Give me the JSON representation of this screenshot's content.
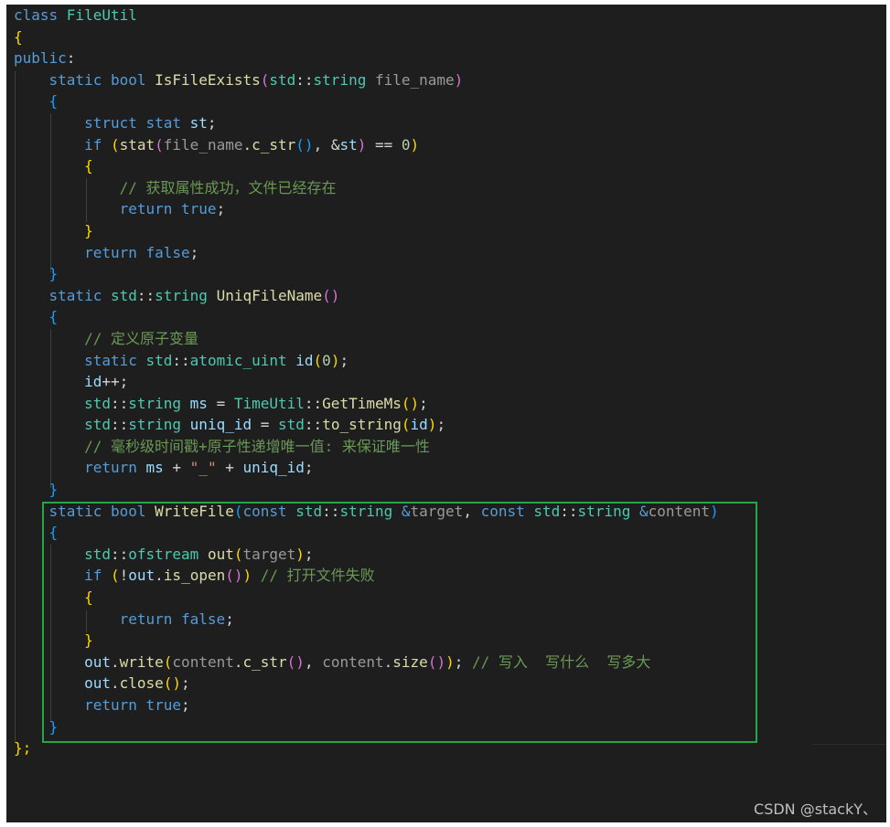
{
  "code_lines": [
    [
      {
        "t": "class ",
        "c": "kw"
      },
      {
        "t": "FileUtil",
        "c": "ty"
      }
    ],
    [
      {
        "t": "{",
        "c": "b1"
      }
    ],
    [
      {
        "t": "public",
        "c": "kw"
      },
      {
        "t": ":",
        "c": "pn"
      }
    ],
    [
      {
        "t": "    static bool ",
        "c": "kw"
      },
      {
        "t": "IsFileExists",
        "c": "fn"
      },
      {
        "t": "(",
        "c": "b2"
      },
      {
        "t": "std",
        "c": "ty"
      },
      {
        "t": "::",
        "c": "pn"
      },
      {
        "t": "string",
        "c": "ty"
      },
      {
        "t": " file_name",
        "c": "prm"
      },
      {
        "t": ")",
        "c": "b2"
      }
    ],
    [
      {
        "t": "    {",
        "c": "b3"
      }
    ],
    [
      {
        "t": "        struct stat ",
        "c": "kw"
      },
      {
        "t": "st",
        "c": "var"
      },
      {
        "t": ";",
        "c": "pn"
      }
    ],
    [
      {
        "t": "        if ",
        "c": "kw"
      },
      {
        "t": "(",
        "c": "b1"
      },
      {
        "t": "stat",
        "c": "fn"
      },
      {
        "t": "(",
        "c": "b2"
      },
      {
        "t": "file_name",
        "c": "prm"
      },
      {
        "t": ".",
        "c": "pn"
      },
      {
        "t": "c_str",
        "c": "fn"
      },
      {
        "t": "()",
        "c": "b3"
      },
      {
        "t": ", &",
        "c": "pn"
      },
      {
        "t": "st",
        "c": "var"
      },
      {
        "t": ")",
        "c": "b2"
      },
      {
        "t": " == ",
        "c": "pn"
      },
      {
        "t": "0",
        "c": "num"
      },
      {
        "t": ")",
        "c": "b1"
      }
    ],
    [
      {
        "t": "        {",
        "c": "b1"
      }
    ],
    [
      {
        "t": "            // 获取属性成功，文件已经存在",
        "c": "cm"
      }
    ],
    [
      {
        "t": "            return true",
        "c": "kw"
      },
      {
        "t": ";",
        "c": "pn"
      }
    ],
    [
      {
        "t": "        }",
        "c": "b1"
      }
    ],
    [
      {
        "t": "        return false",
        "c": "kw"
      },
      {
        "t": ";",
        "c": "pn"
      }
    ],
    [
      {
        "t": "    }",
        "c": "b3"
      }
    ],
    [
      {
        "t": "    static ",
        "c": "kw"
      },
      {
        "t": "std",
        "c": "ty"
      },
      {
        "t": "::",
        "c": "pn"
      },
      {
        "t": "string ",
        "c": "ty"
      },
      {
        "t": "UniqFileName",
        "c": "fn"
      },
      {
        "t": "()",
        "c": "b2"
      }
    ],
    [
      {
        "t": "    {",
        "c": "b3"
      }
    ],
    [
      {
        "t": "        // 定义原子变量",
        "c": "cm"
      }
    ],
    [
      {
        "t": "        static ",
        "c": "kw"
      },
      {
        "t": "std",
        "c": "ty"
      },
      {
        "t": "::",
        "c": "pn"
      },
      {
        "t": "atomic_uint ",
        "c": "ty"
      },
      {
        "t": "id",
        "c": "var"
      },
      {
        "t": "(",
        "c": "b1"
      },
      {
        "t": "0",
        "c": "num"
      },
      {
        "t": ")",
        "c": "b1"
      },
      {
        "t": ";",
        "c": "pn"
      }
    ],
    [
      {
        "t": "        ",
        "c": "pn"
      },
      {
        "t": "id",
        "c": "var"
      },
      {
        "t": "++;",
        "c": "pn"
      }
    ],
    [
      {
        "t": "        ",
        "c": "pn"
      },
      {
        "t": "std",
        "c": "ty"
      },
      {
        "t": "::",
        "c": "pn"
      },
      {
        "t": "string ",
        "c": "ty"
      },
      {
        "t": "ms",
        "c": "var"
      },
      {
        "t": " = ",
        "c": "pn"
      },
      {
        "t": "TimeUtil",
        "c": "ty"
      },
      {
        "t": "::",
        "c": "pn"
      },
      {
        "t": "GetTimeMs",
        "c": "fn"
      },
      {
        "t": "()",
        "c": "b1"
      },
      {
        "t": ";",
        "c": "pn"
      }
    ],
    [
      {
        "t": "        ",
        "c": "pn"
      },
      {
        "t": "std",
        "c": "ty"
      },
      {
        "t": "::",
        "c": "pn"
      },
      {
        "t": "string ",
        "c": "ty"
      },
      {
        "t": "uniq_id",
        "c": "var"
      },
      {
        "t": " = ",
        "c": "pn"
      },
      {
        "t": "std",
        "c": "ty"
      },
      {
        "t": "::",
        "c": "pn"
      },
      {
        "t": "to_string",
        "c": "fn"
      },
      {
        "t": "(",
        "c": "b1"
      },
      {
        "t": "id",
        "c": "var"
      },
      {
        "t": ")",
        "c": "b1"
      },
      {
        "t": ";",
        "c": "pn"
      }
    ],
    [
      {
        "t": "        // 毫秒级时间戳+原子性递增唯一值: 来保证唯一性",
        "c": "cm"
      }
    ],
    [
      {
        "t": "        return ",
        "c": "kw"
      },
      {
        "t": "ms",
        "c": "var"
      },
      {
        "t": " + ",
        "c": "pn"
      },
      {
        "t": "\"_\"",
        "c": "str"
      },
      {
        "t": " + ",
        "c": "pn"
      },
      {
        "t": "uniq_id",
        "c": "var"
      },
      {
        "t": ";",
        "c": "pn"
      }
    ],
    [
      {
        "t": "    }",
        "c": "b3"
      }
    ],
    [
      {
        "t": "    static bool ",
        "c": "kw"
      },
      {
        "t": "WriteFile",
        "c": "fn"
      },
      {
        "t": "(",
        "c": "b3"
      },
      {
        "t": "const ",
        "c": "kw"
      },
      {
        "t": "std",
        "c": "ty"
      },
      {
        "t": "::",
        "c": "pn"
      },
      {
        "t": "string ",
        "c": "ty"
      },
      {
        "t": "&",
        "c": "kw"
      },
      {
        "t": "target",
        "c": "prm"
      },
      {
        "t": ", ",
        "c": "pn"
      },
      {
        "t": "const ",
        "c": "kw"
      },
      {
        "t": "std",
        "c": "ty"
      },
      {
        "t": "::",
        "c": "pn"
      },
      {
        "t": "string ",
        "c": "ty"
      },
      {
        "t": "&",
        "c": "kw"
      },
      {
        "t": "content",
        "c": "prm"
      },
      {
        "t": ")",
        "c": "b3"
      }
    ],
    [
      {
        "t": "    {",
        "c": "b3"
      }
    ],
    [
      {
        "t": "        ",
        "c": "pn"
      },
      {
        "t": "std",
        "c": "ty"
      },
      {
        "t": "::",
        "c": "pn"
      },
      {
        "t": "ofstream ",
        "c": "ty"
      },
      {
        "t": "out",
        "c": "fn"
      },
      {
        "t": "(",
        "c": "b1"
      },
      {
        "t": "target",
        "c": "prm"
      },
      {
        "t": ")",
        "c": "b1"
      },
      {
        "t": ";",
        "c": "pn"
      }
    ],
    [
      {
        "t": "        if ",
        "c": "kw"
      },
      {
        "t": "(",
        "c": "b1"
      },
      {
        "t": "!",
        "c": "pn"
      },
      {
        "t": "out",
        "c": "var"
      },
      {
        "t": ".",
        "c": "pn"
      },
      {
        "t": "is_open",
        "c": "fn"
      },
      {
        "t": "()",
        "c": "b2"
      },
      {
        "t": ")",
        "c": "b1"
      },
      {
        "t": " // 打开文件失败",
        "c": "cm"
      }
    ],
    [
      {
        "t": "        {",
        "c": "b1"
      }
    ],
    [
      {
        "t": "            return false",
        "c": "kw"
      },
      {
        "t": ";",
        "c": "pn"
      }
    ],
    [
      {
        "t": "        }",
        "c": "b1"
      }
    ],
    [
      {
        "t": "        ",
        "c": "pn"
      },
      {
        "t": "out",
        "c": "var"
      },
      {
        "t": ".",
        "c": "pn"
      },
      {
        "t": "write",
        "c": "fn"
      },
      {
        "t": "(",
        "c": "b1"
      },
      {
        "t": "content",
        "c": "prm"
      },
      {
        "t": ".",
        "c": "pn"
      },
      {
        "t": "c_str",
        "c": "fn"
      },
      {
        "t": "()",
        "c": "b2"
      },
      {
        "t": ", ",
        "c": "pn"
      },
      {
        "t": "content",
        "c": "prm"
      },
      {
        "t": ".",
        "c": "pn"
      },
      {
        "t": "size",
        "c": "fn"
      },
      {
        "t": "()",
        "c": "b2"
      },
      {
        "t": ")",
        "c": "b1"
      },
      {
        "t": "; ",
        "c": "pn"
      },
      {
        "t": "// 写入  写什么  写多大",
        "c": "cm"
      }
    ],
    [
      {
        "t": "        ",
        "c": "pn"
      },
      {
        "t": "out",
        "c": "var"
      },
      {
        "t": ".",
        "c": "pn"
      },
      {
        "t": "close",
        "c": "fn"
      },
      {
        "t": "()",
        "c": "b1"
      },
      {
        "t": ";",
        "c": "pn"
      }
    ],
    [
      {
        "t": "        return true",
        "c": "kw"
      },
      {
        "t": ";",
        "c": "pn"
      }
    ],
    [
      {
        "t": "    }",
        "c": "b3"
      }
    ],
    [
      {
        "t": "};",
        "c": "b1"
      }
    ]
  ],
  "watermark": "CSDN @stackY、",
  "colors": {
    "editor_background": "#1e1e1e",
    "highlight_border": "#26a645",
    "keyword": "#569cd6",
    "type": "#4ec9b0",
    "function": "#dcdcaa",
    "variable": "#9cdcfe",
    "parameter": "#9a9a9a",
    "comment": "#6a9955",
    "string": "#ce9178",
    "number": "#b5cea8",
    "bracket_level_1": "#ffd700",
    "bracket_level_2": "#da70d6",
    "bracket_level_3": "#179fff"
  }
}
